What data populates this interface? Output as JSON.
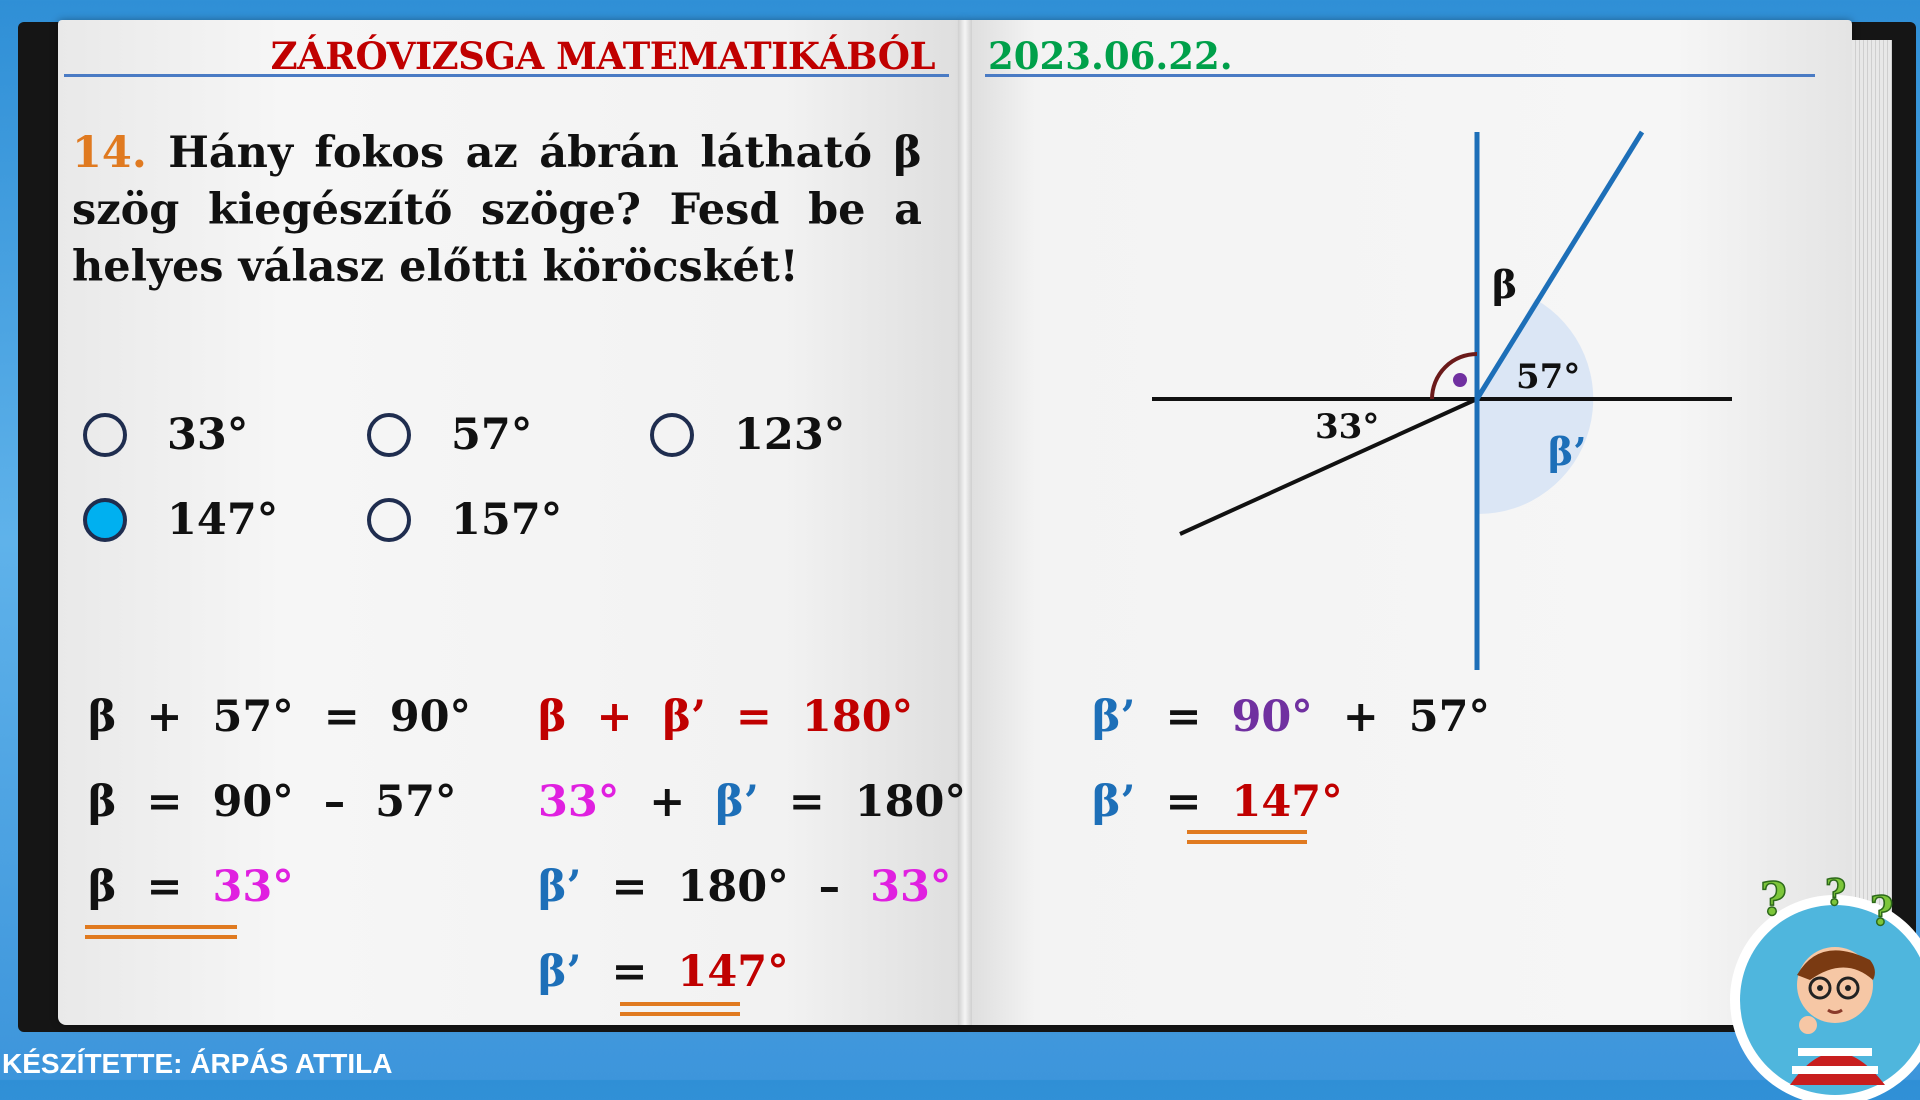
{
  "header": {
    "title": "ZÁRÓVIZSGA MATEMATIKÁBÓL",
    "date": "2023.06.22."
  },
  "question": {
    "number": "14.",
    "text": " Hány fokos az ábrán látható β szög kiegészítő szöge? Fesd be a helyes válasz előtti köröcskét!"
  },
  "options": [
    {
      "label": "33°",
      "selected": false
    },
    {
      "label": "57°",
      "selected": false
    },
    {
      "label": "123°",
      "selected": false
    },
    {
      "label": "147°",
      "selected": true
    },
    {
      "label": "157°",
      "selected": false
    }
  ],
  "diagram": {
    "beta": "β",
    "angle_57": "57°",
    "angle_33": "33°",
    "beta_prime": "β’"
  },
  "solution": {
    "col1": {
      "l1_a": "β  +  57°  =  90°",
      "l2_a": "β  =  90°  –  57°",
      "l3_a": "β  =  ",
      "l3_b": "33°"
    },
    "col2": {
      "l1_a": "β  +  β’  =  180°",
      "l2_a": "33°",
      "l2_b": "  +  ",
      "l2_c": "β’",
      "l2_d": "  =  180°",
      "l3_a": "β’",
      "l3_b": "  =  180°  –  ",
      "l3_c": "33°",
      "l4_a": "β’",
      "l4_b": "  =  ",
      "l4_c": "147°"
    },
    "col3": {
      "l1_a": "β’",
      "l1_b": "  =  ",
      "l1_c": "90°",
      "l1_d": "  +  57°",
      "l2_a": "β’",
      "l2_b": "  =  ",
      "l2_c": "147°"
    }
  },
  "credit": "KÉSZÍTETTE: ÁRPÁS ATTILA",
  "colors": {
    "title_red": "#c00000",
    "date_green": "#00a04a",
    "qnum_orange": "#e07a20",
    "selected_fill": "#00b0f0",
    "line_blue": "#1d6fb8",
    "magenta": "#e020e0",
    "purple": "#7030a0"
  }
}
